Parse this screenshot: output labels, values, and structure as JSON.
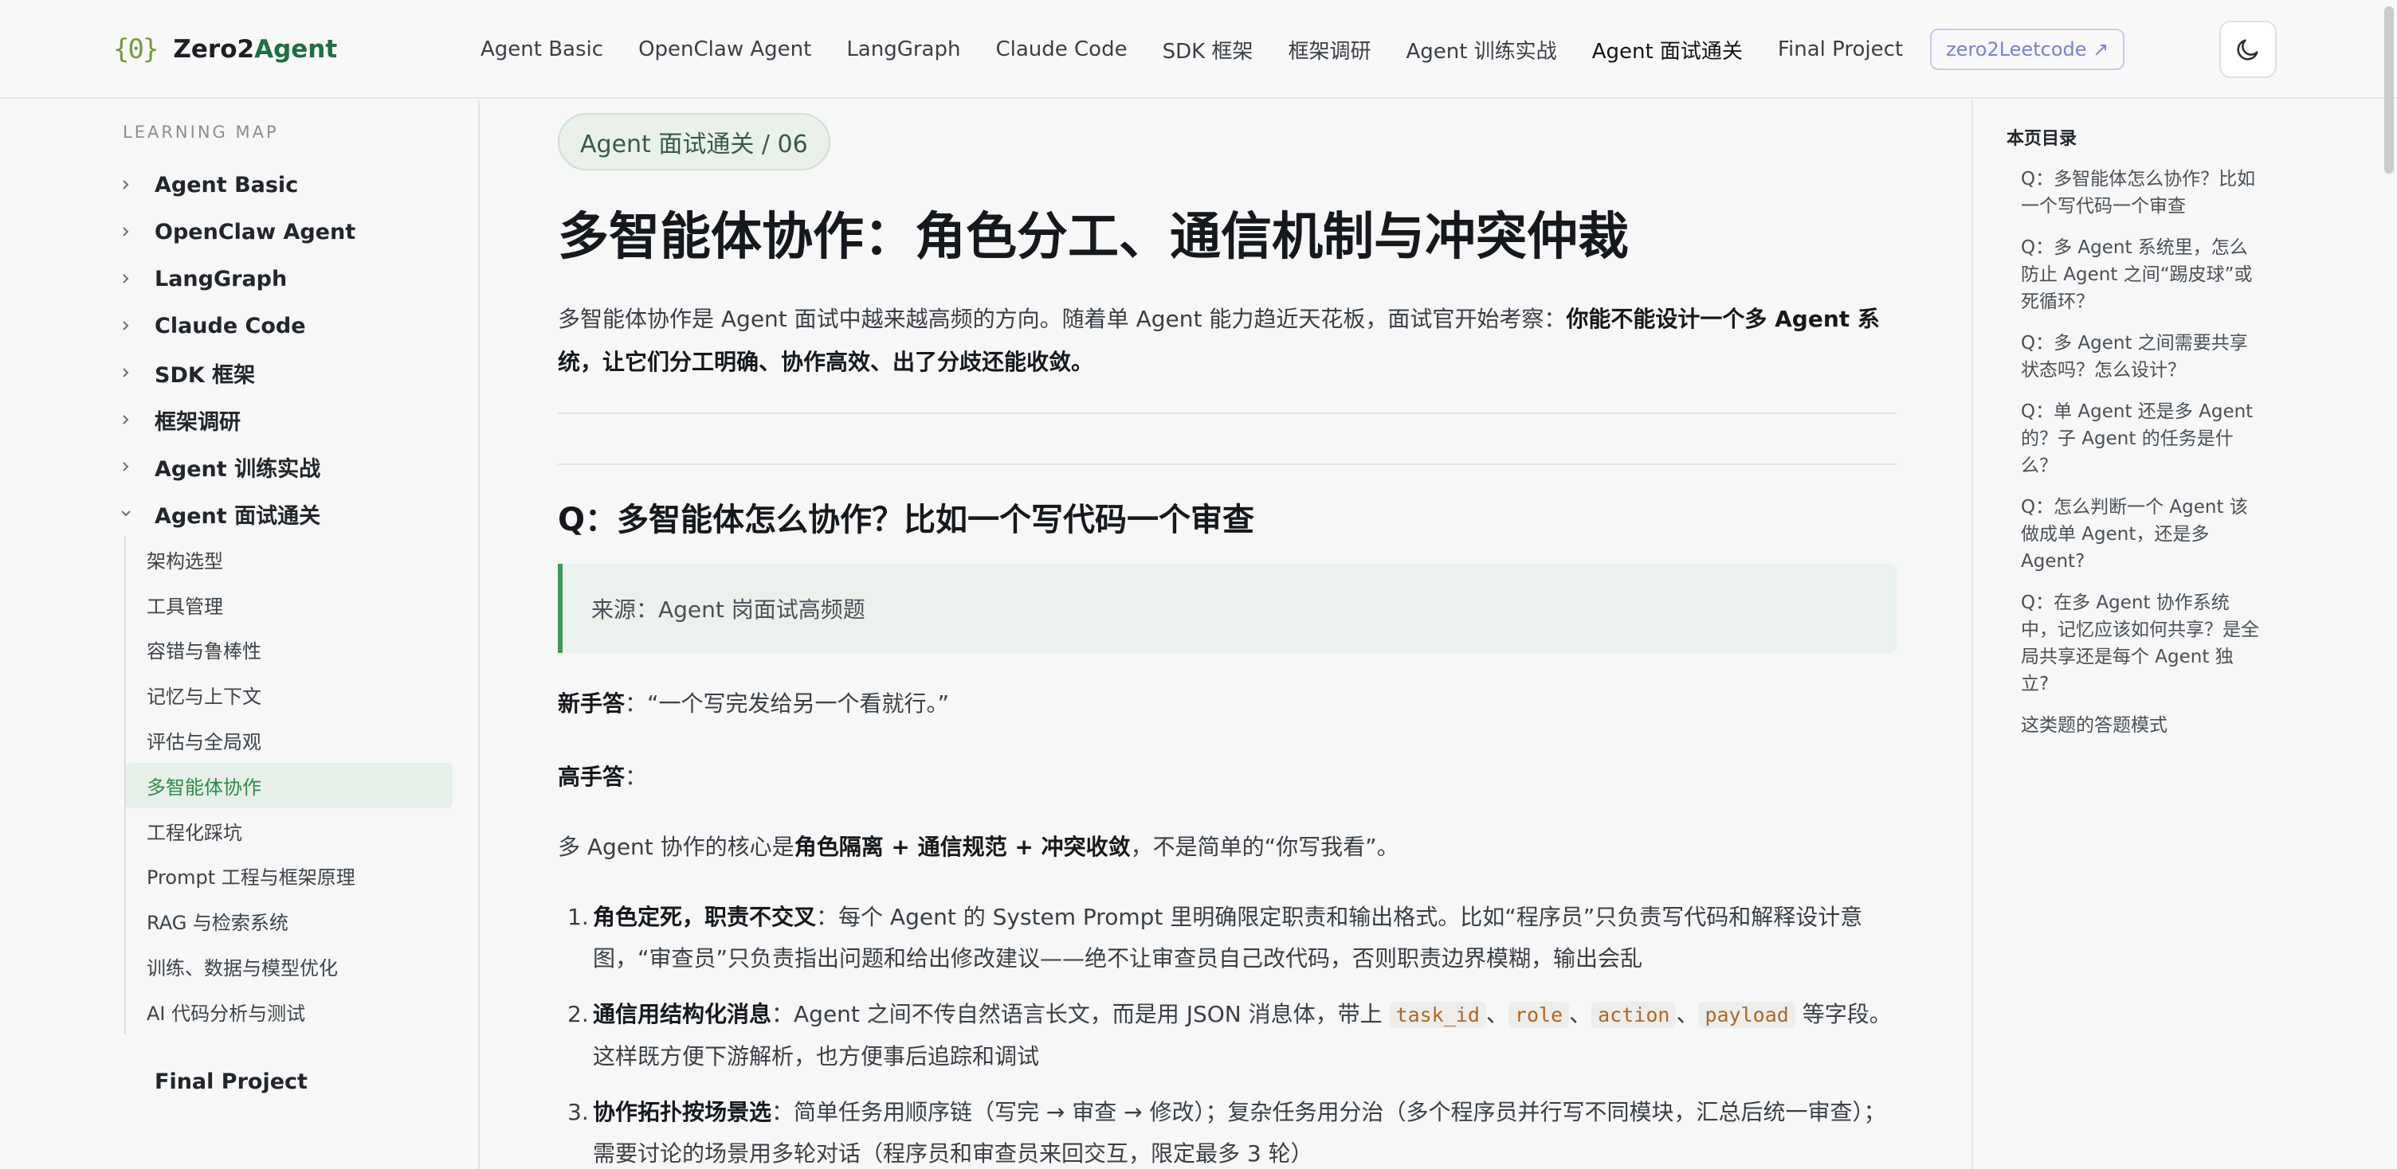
{
  "header": {
    "logo_mark": "{0}",
    "logo_name_a": "Zero2",
    "logo_name_b": "Agent",
    "nav": [
      {
        "label": "Agent Basic",
        "active": false
      },
      {
        "label": "OpenClaw Agent",
        "active": false
      },
      {
        "label": "LangGraph",
        "active": false
      },
      {
        "label": "Claude Code",
        "active": false
      },
      {
        "label": "SDK 框架",
        "active": false
      },
      {
        "label": "框架调研",
        "active": false
      },
      {
        "label": "Agent 训练实战",
        "active": false
      },
      {
        "label": "Agent 面试通关",
        "active": true
      },
      {
        "label": "Final Project",
        "active": false
      }
    ],
    "external_link": "zero2Leetcode ↗",
    "theme_icon": "moon-icon"
  },
  "sidebar": {
    "section_label": "LEARNING MAP",
    "groups": [
      {
        "label": "Agent Basic",
        "expanded": false
      },
      {
        "label": "OpenClaw Agent",
        "expanded": false
      },
      {
        "label": "LangGraph",
        "expanded": false
      },
      {
        "label": "Claude Code",
        "expanded": false
      },
      {
        "label": "SDK 框架",
        "expanded": false
      },
      {
        "label": "框架调研",
        "expanded": false
      },
      {
        "label": "Agent 训练实战",
        "expanded": false
      },
      {
        "label": "Agent 面试通关",
        "expanded": true
      }
    ],
    "sub_items": [
      {
        "label": "架构选型",
        "active": false
      },
      {
        "label": "工具管理",
        "active": false
      },
      {
        "label": "容错与鲁棒性",
        "active": false
      },
      {
        "label": "记忆与上下文",
        "active": false
      },
      {
        "label": "评估与全局观",
        "active": false
      },
      {
        "label": "多智能体协作",
        "active": true
      },
      {
        "label": "工程化踩坑",
        "active": false
      },
      {
        "label": "Prompt 工程与框架原理",
        "active": false
      },
      {
        "label": "RAG 与检索系统",
        "active": false
      },
      {
        "label": "训练、数据与模型优化",
        "active": false
      },
      {
        "label": "AI 代码分析与测试",
        "active": false
      }
    ],
    "final": "Final Project"
  },
  "main": {
    "breadcrumb": "Agent 面试通关 / 06",
    "title": "多智能体协作：角色分工、通信机制与冲突仲裁",
    "intro_plain": "多智能体协作是 Agent 面试中越来越高频的方向。随着单 Agent 能力趋近天花板，面试官开始考察：",
    "intro_bold": "你能不能设计一个多 Agent 系统，让它们分工明确、协作高效、出了分歧还能收敛。",
    "q_heading": "Q：多智能体怎么协作？比如一个写代码一个审查",
    "quote": "来源：Agent 岗面试高频题",
    "novice_label": "新手答",
    "novice_text": "：“一个写完发给另一个看就行。”",
    "expert_label": "高手答",
    "expert_text": "：",
    "core_prefix": "多 Agent 协作的核心是",
    "core_bold": "角色隔离 + 通信规范 + 冲突收敛",
    "core_suffix": "，不是简单的“你写我看”。",
    "list": [
      {
        "num": "1.",
        "bold": "角色定死，职责不交叉",
        "text": "：每个 Agent 的 System Prompt 里明确限定职责和输出格式。比如“程序员”只负责写代码和解释设计意图，“审查员”只负责指出问题和给出修改建议——绝不让审查员自己改代码，否则职责边界模糊，输出会乱"
      },
      {
        "num": "2.",
        "bold": "通信用结构化消息",
        "text_a": "：Agent 之间不传自然语言长文，而是用 JSON 消息体，带上 ",
        "code1": "task_id",
        "sep1": "、",
        "code2": "role",
        "sep2": "、",
        "code3": "action",
        "sep3": "、",
        "code4": "payload",
        "text_b": " 等字段。这样既方便下游解析，也方便事后追踪和调试"
      },
      {
        "num": "3.",
        "bold": "协作拓扑按场景选",
        "text": "：简单任务用顺序链（写完 → 审查 → 修改）；复杂任务用分治（多个程序员并行写不同模块，汇总后统一审查）；需要讨论的场景用多轮对话（程序员和审查员来回交互，限定最多 3 轮）"
      }
    ]
  },
  "toc": {
    "title": "本页目录",
    "items": [
      "Q：多智能体怎么协作？比如一个写代码一个审查",
      "Q：多 Agent 系统里，怎么防止 Agent 之间“踢皮球”或死循环？",
      "Q：多 Agent 之间需要共享状态吗？怎么设计？",
      "Q：单 Agent 还是多 Agent 的？子 Agent 的任务是什么？",
      "Q：怎么判断一个 Agent 该做成单 Agent，还是多 Agent?",
      "Q：在多 Agent 协作系统中，记忆应该如何共享？是全局共享还是每个 Agent 独立?",
      "这类题的答题模式"
    ]
  },
  "colors": {
    "accent": "#2e8a4a",
    "link": "#7d7fd8",
    "code": "#b5651d"
  }
}
